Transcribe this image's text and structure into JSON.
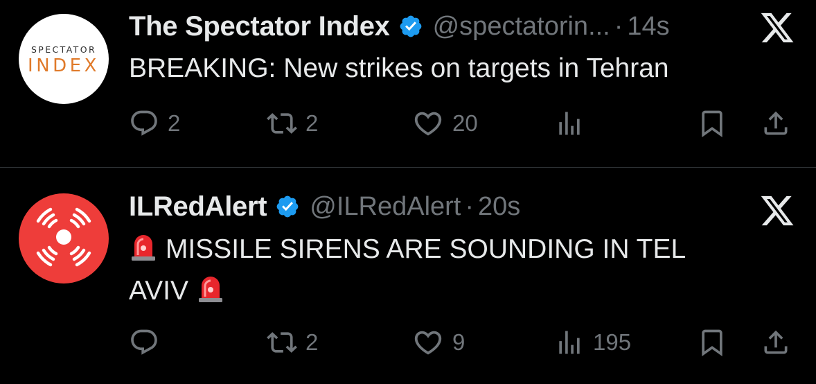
{
  "colors": {
    "background": "#000000",
    "text": "#e7e9ea",
    "muted": "#71767b",
    "verified": "#1d9bf0",
    "divider": "#2f3336"
  },
  "tweets": [
    {
      "avatar": {
        "logo_top": "SPECTATOR",
        "logo_bottom": "INDEX"
      },
      "name": "The Spectator Index",
      "handle": "@spectatorin...",
      "dot": "·",
      "time": "14s",
      "text": "BREAKING: New strikes on targets in Tehran",
      "replies": "2",
      "reposts": "2",
      "likes": "20",
      "views": ""
    },
    {
      "avatar": {
        "icon": "siren-logo-icon"
      },
      "name": "ILRedAlert",
      "handle": "@ILRedAlert",
      "dot": "·",
      "time": "20s",
      "text_part1": "MISSILE SIRENS ARE SOUNDING IN TEL",
      "text_part2": "AVIV",
      "replies": "",
      "reposts": "2",
      "likes": "9",
      "views": "195"
    }
  ]
}
